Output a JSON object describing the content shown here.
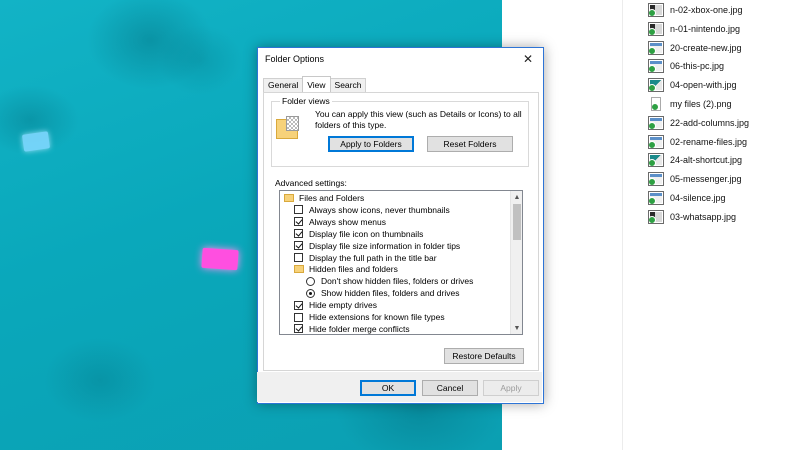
{
  "dialog": {
    "title": "Folder Options",
    "close_glyph": "✕",
    "tabs": [
      "General",
      "View",
      "Search"
    ],
    "folder_views": {
      "legend": "Folder views",
      "description": "You can apply this view (such as Details or Icons) to all folders of this type.",
      "apply_label": "Apply to Folders",
      "reset_label": "Reset Folders"
    },
    "advanced_label": "Advanced settings:",
    "advanced": [
      {
        "type": "folder",
        "label": "Files and Folders"
      },
      {
        "type": "checkbox",
        "label": "Always show icons, never thumbnails",
        "checked": false
      },
      {
        "type": "checkbox",
        "label": "Always show menus",
        "checked": true
      },
      {
        "type": "checkbox",
        "label": "Display file icon on thumbnails",
        "checked": true
      },
      {
        "type": "checkbox",
        "label": "Display file size information in folder tips",
        "checked": true
      },
      {
        "type": "checkbox",
        "label": "Display the full path in the title bar",
        "checked": false
      },
      {
        "type": "folder",
        "label": "Hidden files and folders"
      },
      {
        "type": "radio",
        "label": "Don't show hidden files, folders or drives",
        "checked": false
      },
      {
        "type": "radio",
        "label": "Show hidden files, folders and drives",
        "checked": true
      },
      {
        "type": "checkbox",
        "label": "Hide empty drives",
        "checked": true
      },
      {
        "type": "checkbox",
        "label": "Hide extensions for known file types",
        "checked": false
      },
      {
        "type": "checkbox",
        "label": "Hide folder merge conflicts",
        "checked": true
      }
    ],
    "restore_label": "Restore Defaults",
    "ok_label": "OK",
    "cancel_label": "Cancel",
    "apply_label": "Apply"
  },
  "files": [
    {
      "name": "n-02-xbox-one.jpg",
      "icon": "dark"
    },
    {
      "name": "n-01-nintendo.jpg",
      "icon": "dark"
    },
    {
      "name": "20-create-new.jpg",
      "icon": "light"
    },
    {
      "name": "06-this-pc.jpg",
      "icon": "light"
    },
    {
      "name": "04-open-with.jpg",
      "icon": "teal"
    },
    {
      "name": "my files (2).png",
      "icon": "doc"
    },
    {
      "name": "22-add-columns.jpg",
      "icon": "light"
    },
    {
      "name": "02-rename-files.jpg",
      "icon": "light"
    },
    {
      "name": "24-alt-shortcut.jpg",
      "icon": "teal"
    },
    {
      "name": "05-messenger.jpg",
      "icon": "light"
    },
    {
      "name": "04-silence.jpg",
      "icon": "light"
    },
    {
      "name": "03-whatsapp.jpg",
      "icon": "dark"
    }
  ]
}
